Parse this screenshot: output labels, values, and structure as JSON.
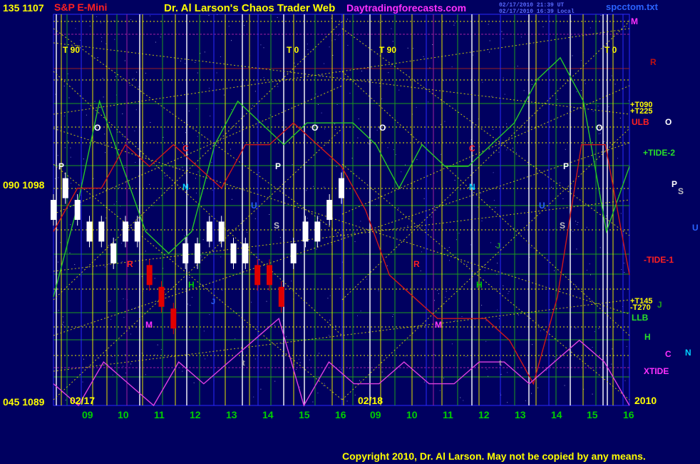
{
  "header": {
    "left_price_top": "135 1107",
    "instrument": "S&P E-Mini",
    "title": "Dr. Al Larson's Chaos Trader Web",
    "site": "Daytradingforecasts.com",
    "stamp1": "02/17/2010 21:39 UT",
    "stamp2": "02/17/2010 16:39 Local",
    "file": "spcctom.txt"
  },
  "axis": {
    "mid_label": "090 1098",
    "bottom_label": "045 1089",
    "date1": "02/17",
    "date2": "02/18",
    "year": "2010",
    "hours": [
      "09",
      "10",
      "11",
      "12",
      "13",
      "14",
      "15",
      "16",
      "09",
      "10",
      "11",
      "12",
      "13",
      "14",
      "15",
      "16"
    ]
  },
  "tide_labels": {
    "t90_a": "T 90",
    "t0_a": "T 0",
    "t90_b": "T 90",
    "t0_b": "T 0",
    "o": "O",
    "c": "C",
    "n": "N",
    "p": "P",
    "s": "S",
    "u": "U",
    "r": "R",
    "h": "H",
    "m": "M",
    "j": "J",
    "t": "t"
  },
  "right_labels": {
    "m": "M",
    "r": "R",
    "t090": "+T090",
    "t225": "+T225",
    "ulb": "ULB",
    "o": "O",
    "tide2": "+TIDE-2",
    "p": "P",
    "s": "S",
    "u": "U",
    "tide1": "-TIDE-1",
    "t145": "+T145",
    "t270": "-T270",
    "j": "J",
    "llb": "LLB",
    "h": "H",
    "c": "C",
    "n": "N",
    "xtide": "XTIDE"
  },
  "footer": {
    "copyright": "Copyright 2010, Dr. Al Larson. May not be copied by any means."
  },
  "colors": {
    "background": "#000060",
    "grid_yellow": "#e6e600",
    "grid_green": "#1e9c1e",
    "grid_blue": "#2a2aff",
    "white_line": "#ffffff",
    "violet_line": "#a020a0",
    "tide_green": "#28c828",
    "tide_red": "#d01818",
    "xtide": "#e040e0",
    "price_white": "#ffffff",
    "price_red": "#e00000",
    "label_yellow": "#ffff00",
    "label_green": "#00d000",
    "label_cyan": "#00d0ff",
    "label_magenta": "#ff30ff",
    "label_blue": "#2b63ff",
    "label_orange": "#ff7a00"
  },
  "chart_data": {
    "type": "line",
    "title": "S&P E-Mini",
    "y_prices": [
      1089,
      1098,
      1107
    ],
    "y_angles": [
      "045",
      "090",
      "135"
    ],
    "sessions": [
      "02/17",
      "02/18"
    ],
    "hour_ticks": [
      "09",
      "10",
      "11",
      "12",
      "13",
      "14",
      "15",
      "16",
      "09",
      "10",
      "11",
      "12",
      "13",
      "14",
      "15",
      "16"
    ],
    "series": [
      {
        "name": "TIDE-2 (green)",
        "values": [
          1094,
          1098,
          1103,
          1100,
          1097,
          1096,
          1097,
          1101,
          1103,
          1102,
          1101,
          1102,
          1102,
          1102,
          1101,
          1099,
          1101,
          1100,
          1100,
          1101,
          1102,
          1104,
          1105,
          1103,
          1097,
          1100
        ]
      },
      {
        "name": "TIDE-1 (red)",
        "values": [
          1097,
          1099,
          1099,
          1101,
          1100,
          1101,
          1100,
          1099,
          1101,
          1101,
          1102,
          1101,
          1100,
          1098,
          1095,
          1094,
          1093,
          1093,
          1093,
          1092,
          1090,
          1094,
          1101,
          1101,
          1095
        ]
      },
      {
        "name": "XTIDE",
        "values": [
          1090,
          1089,
          1091,
          1090,
          1089,
          1091,
          1090,
          1091,
          1092,
          1093,
          1089,
          1091,
          1090,
          1090,
          1091,
          1090,
          1090,
          1091,
          1091,
          1090,
          1091,
          1092,
          1091,
          1089
        ]
      },
      {
        "name": "S&P E-Mini price",
        "values": [
          1098,
          1099,
          1098,
          1097,
          1097,
          1096,
          1097,
          1097,
          1095,
          1094,
          1093,
          1096,
          1096,
          1097,
          1097,
          1096,
          1096,
          1095,
          1095,
          1094,
          1096,
          1097,
          1097,
          1098,
          1099
        ]
      }
    ]
  }
}
